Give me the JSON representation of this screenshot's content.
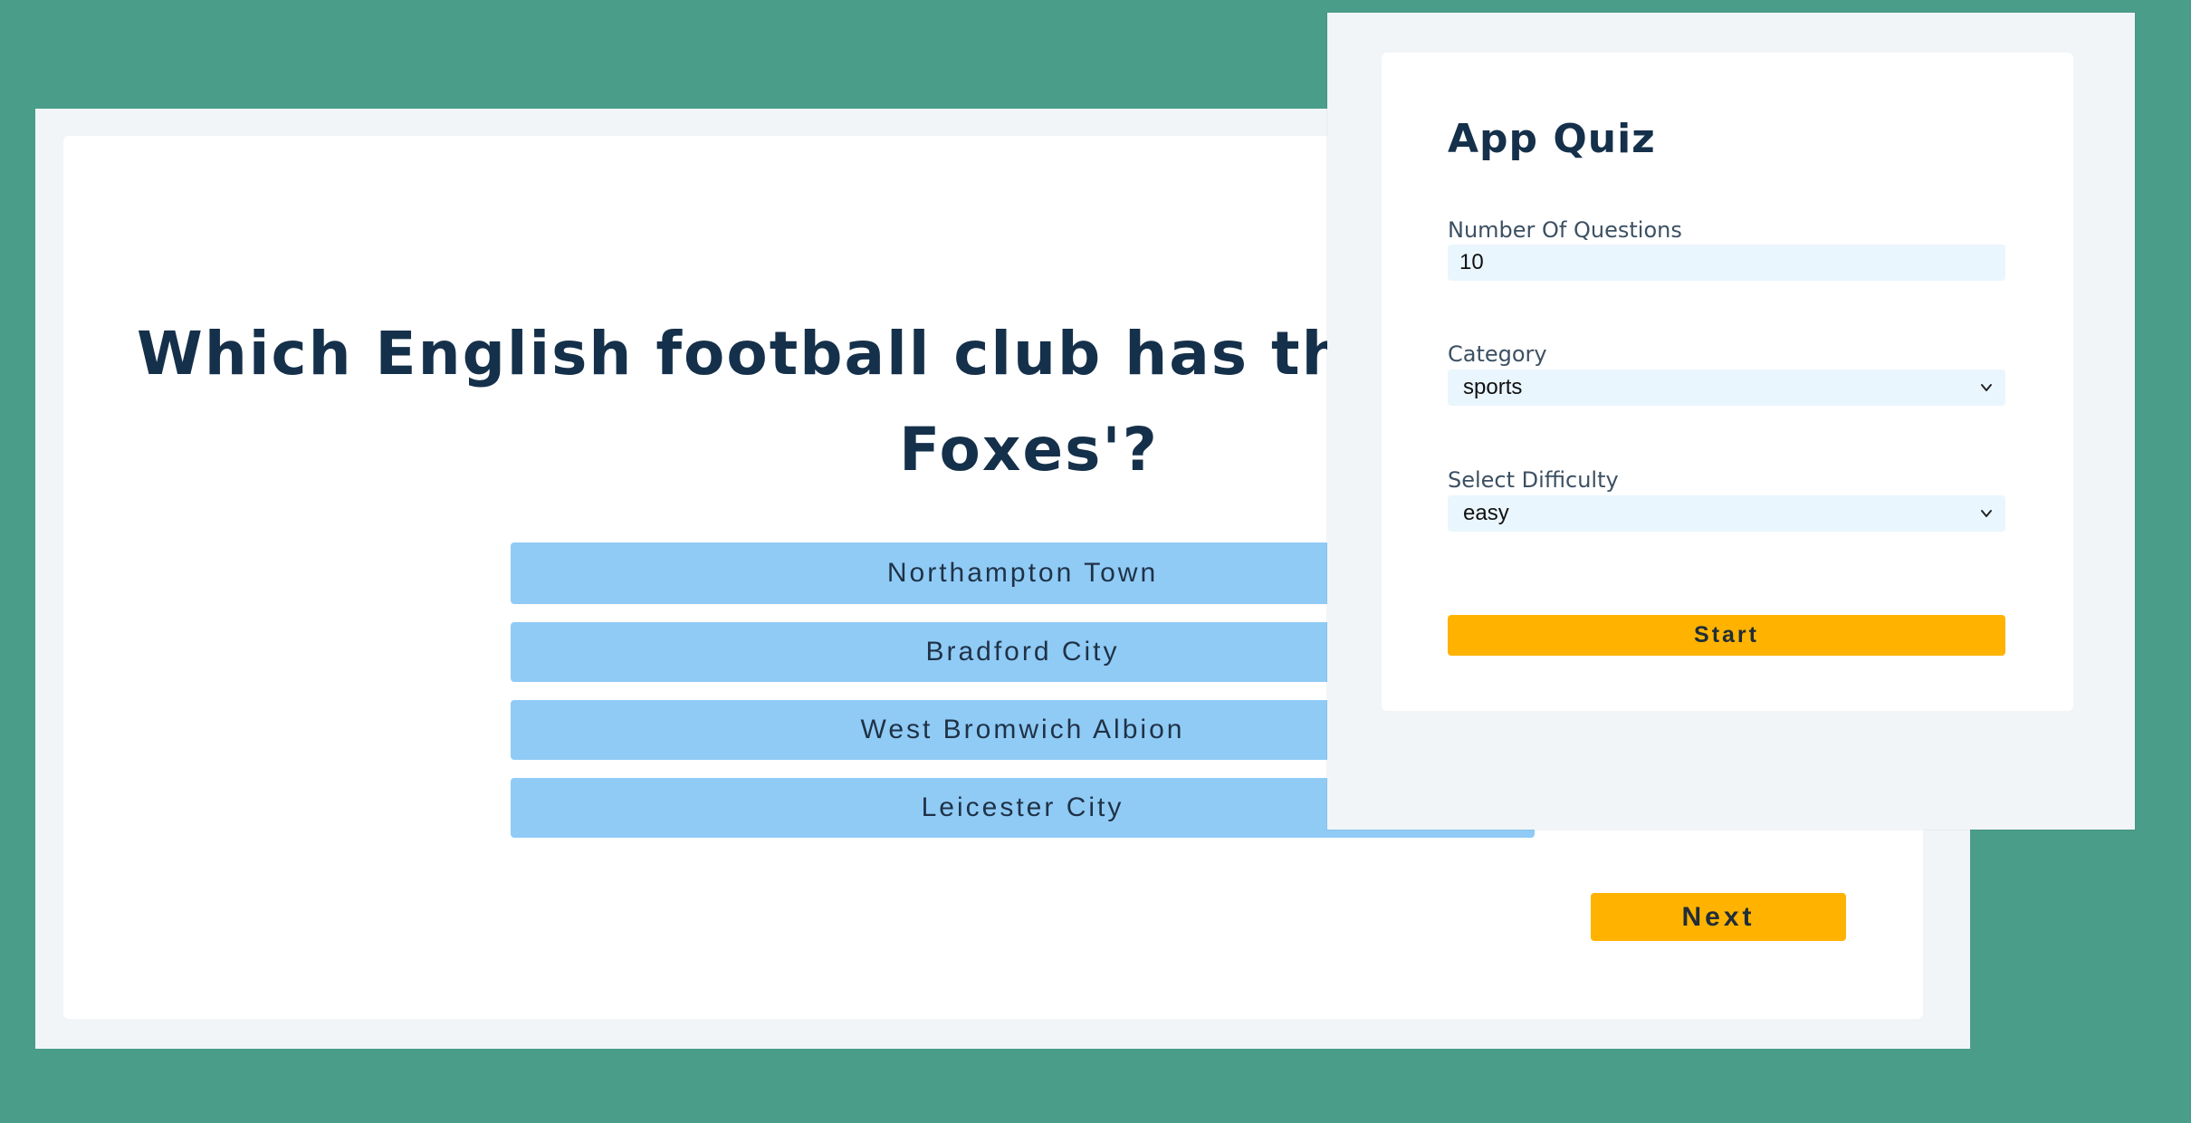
{
  "quiz": {
    "question": "Which English football club has the nickname 'The Foxes'?",
    "answers": [
      {
        "label": "Northampton Town"
      },
      {
        "label": "Bradford City"
      },
      {
        "label": "West Bromwich Albion"
      },
      {
        "label": "Leicester City"
      }
    ],
    "next_label": "Next"
  },
  "settings": {
    "title": "App Quiz",
    "questions_label": "Number Of Questions",
    "questions_value": "10",
    "category_label": "Category",
    "category_value": "sports",
    "difficulty_label": "Select Difficulty",
    "difficulty_value": "easy",
    "start_label": "Start",
    "select_icon": "chevron-down-icon"
  },
  "colors": {
    "background": "#4a9d89",
    "panel": "#f1f5f8",
    "answer": "#90cbf6",
    "accent": "#ffb300",
    "heading": "#15304a",
    "field": "#eaf6fd"
  }
}
